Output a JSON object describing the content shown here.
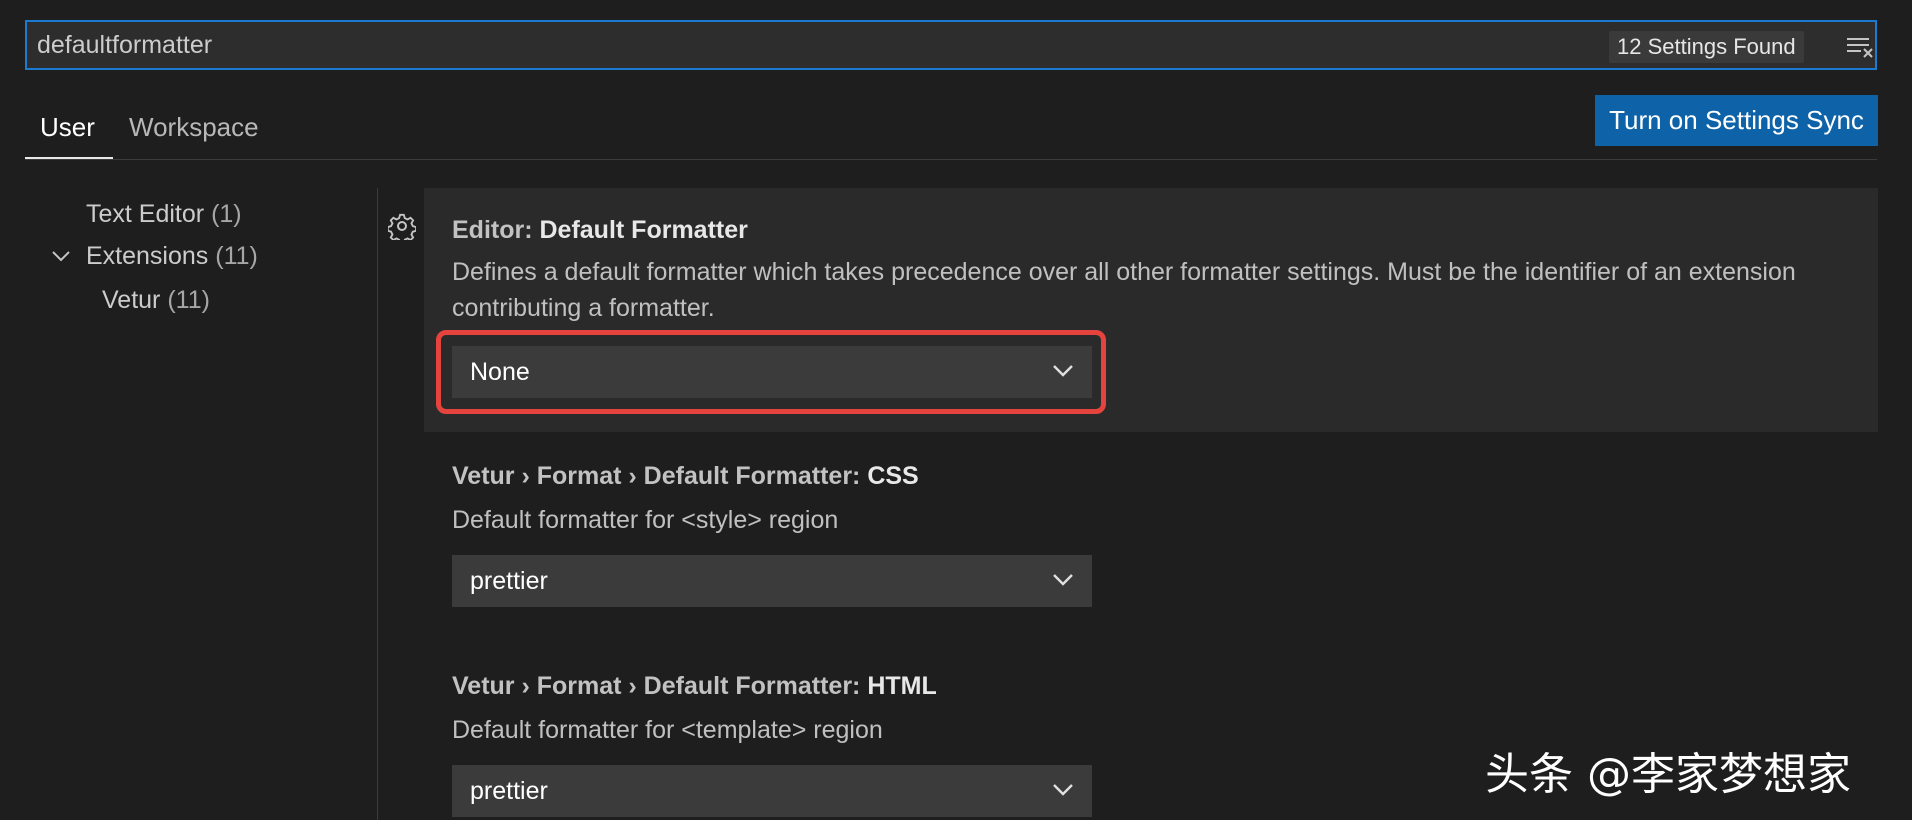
{
  "search": {
    "value": "defaultformatter",
    "result_count": "12 Settings Found"
  },
  "tabs": [
    {
      "label": "User",
      "active": true
    },
    {
      "label": "Workspace",
      "active": false
    }
  ],
  "sync_button": "Turn on Settings Sync",
  "toc": [
    {
      "label": "Text Editor",
      "count": "(1)"
    },
    {
      "label": "Extensions",
      "count": "(11)",
      "expanded": true
    },
    {
      "label": "Vetur",
      "count": "(11)"
    }
  ],
  "settings": [
    {
      "category": "Editor: ",
      "key": "Default Formatter",
      "description": "Defines a default formatter which takes precedence over all other formatter settings. Must be the identifier of an extension contributing a formatter.",
      "value": "None"
    },
    {
      "category": "Vetur › Format › Default Formatter: ",
      "key": "CSS",
      "description": "Default formatter for <style> region",
      "value": "prettier"
    },
    {
      "category": "Vetur › Format › Default Formatter: ",
      "key": "HTML",
      "description": "Default formatter for <template> region",
      "value": "prettier"
    }
  ],
  "watermark": "头条 @李家梦想家",
  "colors": {
    "background": "#1e1e1e",
    "accent": "#0e63a8",
    "search_border": "#1a7bd0",
    "highlight": "#e5443e"
  },
  "icons": [
    "clear-filter-icon",
    "gear-icon",
    "chevron-down-icon"
  ]
}
